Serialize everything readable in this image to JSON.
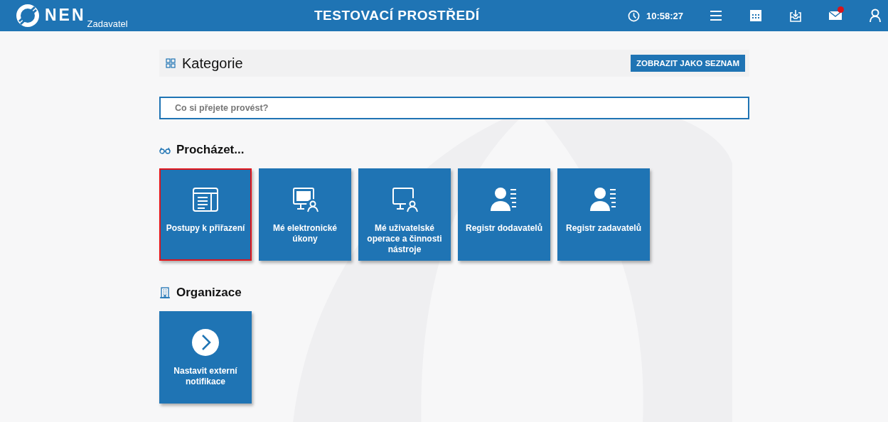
{
  "header": {
    "brand": "NEN",
    "subtitle": "Zadavatel",
    "title": "TESTOVACÍ PROSTŘEDÍ",
    "time": "10:58:27",
    "icons": [
      {
        "kind": "menu"
      },
      {
        "kind": "calendar"
      },
      {
        "kind": "inbox"
      },
      {
        "kind": "mail",
        "notification": true
      },
      {
        "kind": "user"
      }
    ]
  },
  "category_bar": {
    "title": "Kategorie",
    "button": "ZOBRAZIT JAKO SEZNAM"
  },
  "search": {
    "placeholder": "Co si přejete provést?"
  },
  "sections": [
    {
      "kind": "browse",
      "title": "Procházet...",
      "tiles": [
        {
          "kind": "document",
          "label": "Postupy k přiřazení",
          "selected": true
        },
        {
          "kind": "monitor-user-filled",
          "label": "Mé elektronické úkony",
          "selected": false
        },
        {
          "kind": "monitor-user",
          "label": "Mé uživatelské operace a činnosti nástroje",
          "selected": false
        },
        {
          "kind": "user-list",
          "label": "Registr dodavatelů",
          "selected": false
        },
        {
          "kind": "user-list",
          "label": "Registr zadavatelů",
          "selected": false
        }
      ]
    },
    {
      "kind": "organization",
      "title": "Organizace",
      "tiles": [
        {
          "kind": "arrow-circle",
          "label": "Nastavit externí notifikace",
          "selected": false
        }
      ]
    }
  ]
}
